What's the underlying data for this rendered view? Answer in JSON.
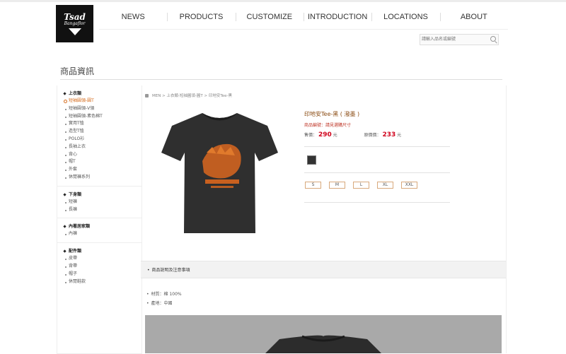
{
  "logo": {
    "line1": "Tsad",
    "line2": "Bangaflor"
  },
  "nav": [
    "NEWS",
    "PRODUCTS",
    "CUSTOMIZE",
    "INTRODUCTION",
    "LOCATIONS",
    "ABOUT"
  ],
  "search": {
    "placeholder": "請輸入品名或編號"
  },
  "page_title": "商品資訊",
  "sidebar": {
    "groups": [
      {
        "title": "上衣類",
        "items": [
          "短袖圓領-圓T",
          "短袖圓領-V領",
          "短袖圓領-素色棉T",
          "實用T恤",
          "造型T恤",
          "POLO衫",
          "長袖上衣",
          "背心",
          "帽T",
          "外套",
          "休閒褲系列"
        ],
        "active_index": 0
      },
      {
        "title": "下身類",
        "items": [
          "短褲",
          "長褲"
        ]
      },
      {
        "title": "內著居家類",
        "items": [
          "內褲"
        ]
      },
      {
        "title": "配件類",
        "items": [
          "皮帶",
          "背帶",
          "帽子",
          "休閒鞋款"
        ]
      }
    ]
  },
  "breadcrumb": "MEN > 上衣類-短袖圓領-圓T > 印地安Tee-黑",
  "product": {
    "name": "印地安Tee-黑 ( 潑墨 )",
    "subtitle": "商品編號：請見選購尺寸",
    "price_label": "售價：",
    "price": "290",
    "price_unit": "元",
    "sale_label": "原價價：",
    "sale_price": "233",
    "sale_unit": "元",
    "swatch_color": "#333333",
    "sizes": [
      "S",
      "M",
      "L",
      "XL",
      "XXL"
    ]
  },
  "notes": {
    "title": "商品說明及注意事項"
  },
  "specs": [
    "材質：棉 100%",
    "產地：中國"
  ],
  "colors": {
    "accent": "#d46b1c",
    "price": "#d0021b"
  }
}
